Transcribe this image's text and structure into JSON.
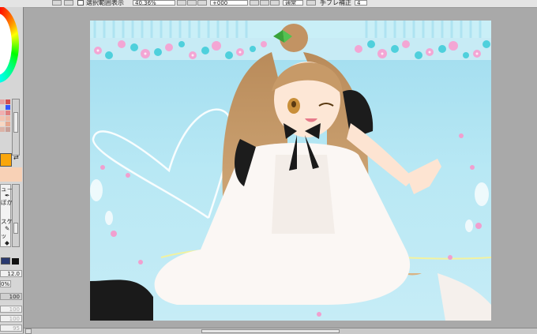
{
  "toolbar": {
    "checkbox_label": "選択範囲表示",
    "zoom_value": "40.36%",
    "rotation_value": "+000",
    "quality_mode": "通常",
    "stabilizer_label": "手ブレ補正",
    "stabilizer_value": "4"
  },
  "left_panel": {
    "tool_labels": [
      "ュ－",
      "ぼかし",
      "スケ",
      "ッ"
    ],
    "brush_size": "12.0",
    "density": "0%",
    "values": [
      "100",
      "100",
      "100",
      "95"
    ]
  },
  "colors": {
    "main_color": "#f9a60c",
    "sub_color": "#f8d1b6",
    "window_bg": "#a9a9a9",
    "panel_bg": "#d6d6d6",
    "sky": "#b5e6f3"
  },
  "icons": [
    "color-wheel-icon",
    "swap-colors-icon",
    "brush-icon",
    "pencil-icon",
    "eraser-icon",
    "brush-shape-icon"
  ]
}
